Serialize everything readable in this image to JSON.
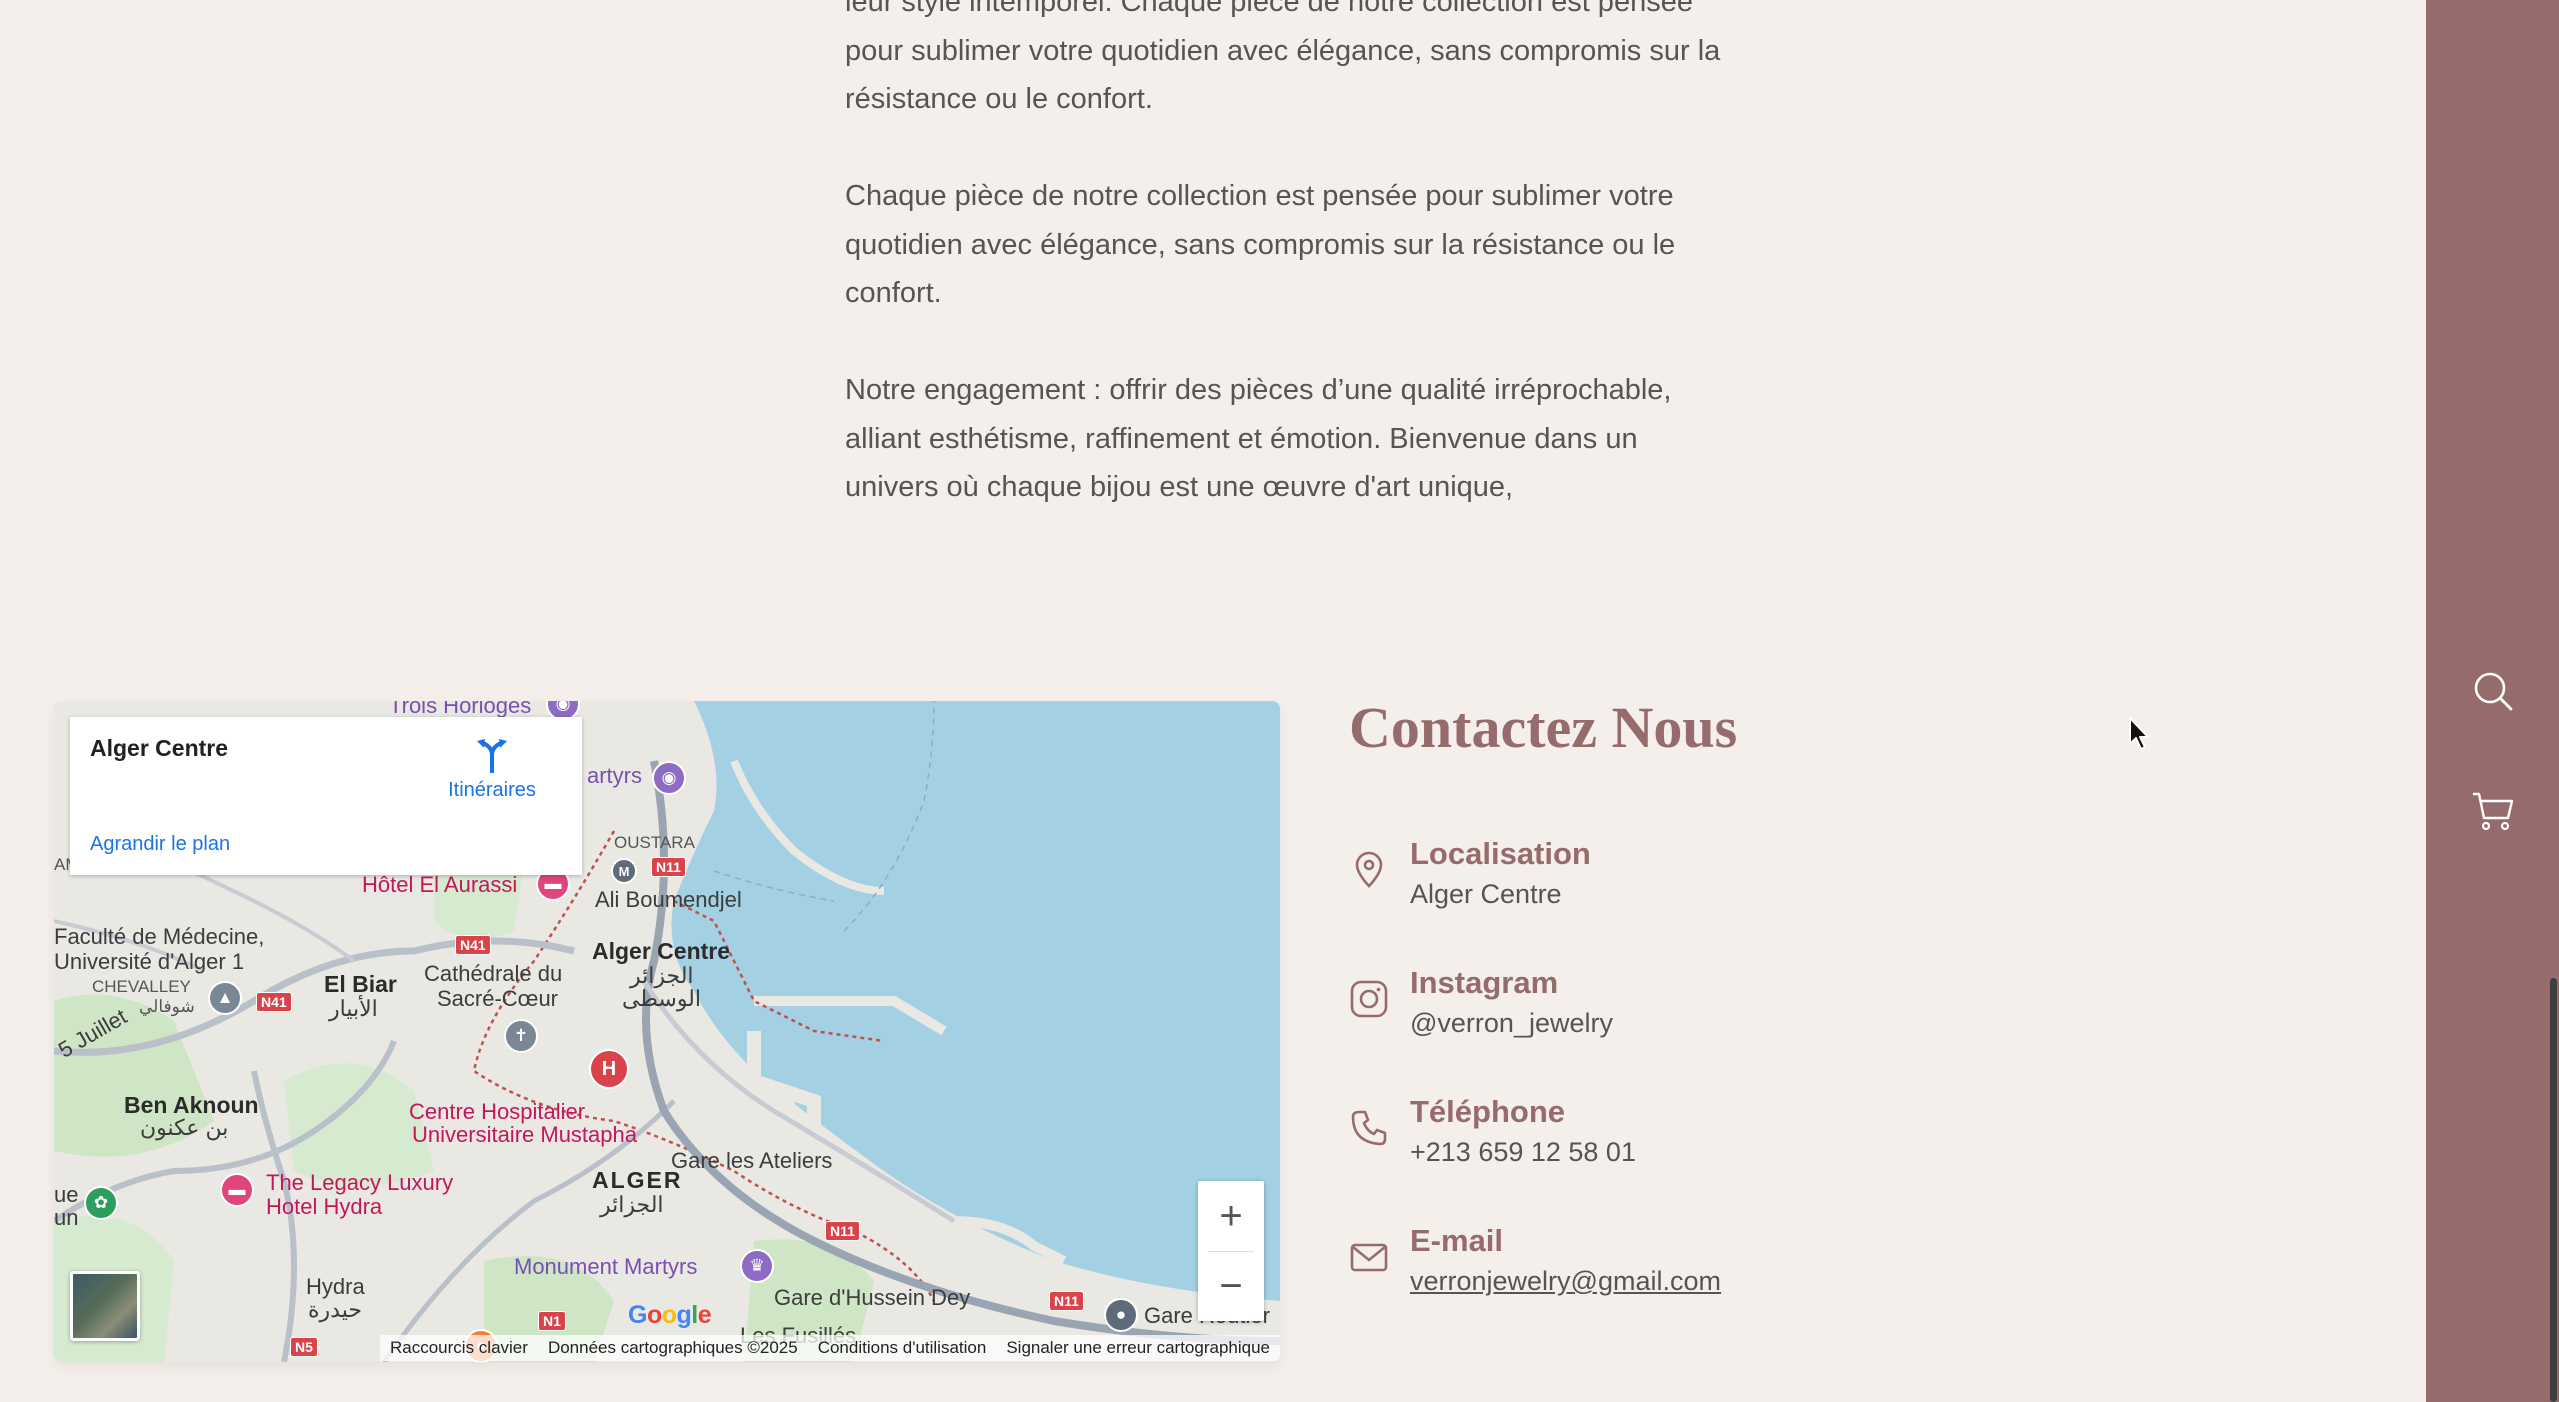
{
  "about": {
    "paragraphs": [
      "leur style intemporel. Chaque pièce de notre collection est pensée pour sublimer votre quotidien avec élégance, sans compromis sur la résistance ou le confort.",
      "Chaque pièce de notre collection est pensée pour sublimer votre quotidien avec élégance, sans compromis sur la résistance ou le confort.",
      "Notre engagement : offrir des pièces d’une qualité irréprochable, alliant esthétisme, raffinement et émotion. Bienvenue dans un univers où chaque bijou est une œuvre d'art unique,"
    ]
  },
  "map": {
    "card": {
      "place": "Alger Centre",
      "directions": "Itinéraires",
      "enlarge": "Agrandir le plan"
    },
    "labels": {
      "trois_horloges": "Trois Horloges",
      "martyrs_top": "artyrs",
      "moustara": "OUSTARA",
      "hotel_aurassi": "Hôtel El Aurassi",
      "ali_boumendjel": "Ali Boumendjel",
      "fac_medecine_1": "Faculté de Médecine,",
      "fac_medecine_2": "Université d'Alger 1",
      "chevalley": "CHEVALLEY",
      "chevalley_ar": "شوفالي",
      "el_biar": "El Biar",
      "el_biar_ar": "الأبيار",
      "cathedrale_1": "Cathédrale du",
      "cathedrale_2": "Sacré-Cœur",
      "alger_centre": "Alger Centre",
      "alger_centre_ar_1": "الجزائر",
      "alger_centre_ar_2": "الوسطى",
      "juillet": "5 Juillet",
      "ben_aknoun": "Ben Aknoun",
      "ben_aknoun_ar": "بن عكنون",
      "chu_1": "Centre Hospitalier",
      "chu_2": "Universitaire Mustapha",
      "alger": "ALGER",
      "alger_ar": "الجزائر",
      "gare_ateliers": "Gare les Ateliers",
      "legacy_1": "The Legacy Luxury",
      "legacy_2": "Hotel Hydra",
      "monument": "Monument Martyrs",
      "hydra": "Hydra",
      "hydra_ar": "حيدرة",
      "gare_hussein": "Gare d'Hussein Dey",
      "gare_routier": "Gare Routier",
      "fusillés": "Les Fusillés",
      "ue": "ue",
      "un": "un",
      "amines": "AMINES"
    },
    "roads": [
      "N11",
      "N41",
      "N41",
      "N11",
      "N11",
      "N1",
      "N5"
    ],
    "google": [
      "G",
      "o",
      "o",
      "g",
      "l",
      "e"
    ],
    "google_colors": [
      "#4285F4",
      "#EA4335",
      "#FBBC05",
      "#4285F4",
      "#34A853",
      "#EA4335"
    ],
    "zoom_in": "+",
    "zoom_out": "−",
    "attribution": {
      "shortcuts": "Raccourcis clavier",
      "data": "Données cartographiques ©2025",
      "terms": "Conditions d'utilisation",
      "report": "Signaler une erreur cartographique"
    }
  },
  "contact": {
    "title": "Contactez Nous",
    "items": [
      {
        "label": "Localisation",
        "value": "Alger Centre",
        "icon": "location-pin-icon"
      },
      {
        "label": "Instagram",
        "value": "@verron_jewelry",
        "icon": "instagram-icon"
      },
      {
        "label": "Téléphone",
        "value": "+213 659 12 58 01",
        "icon": "phone-icon"
      },
      {
        "label": "E-mail",
        "value": "verronjewelry@gmail.com",
        "icon": "mail-icon"
      }
    ]
  },
  "sidebar": {
    "icons": [
      "search-icon",
      "cart-icon"
    ],
    "color": "#966b6b"
  },
  "colors": {
    "accent": "#966b6b",
    "background": "#f4efeb",
    "water": "#a3d0e2",
    "map_link": "#1a73e8"
  }
}
